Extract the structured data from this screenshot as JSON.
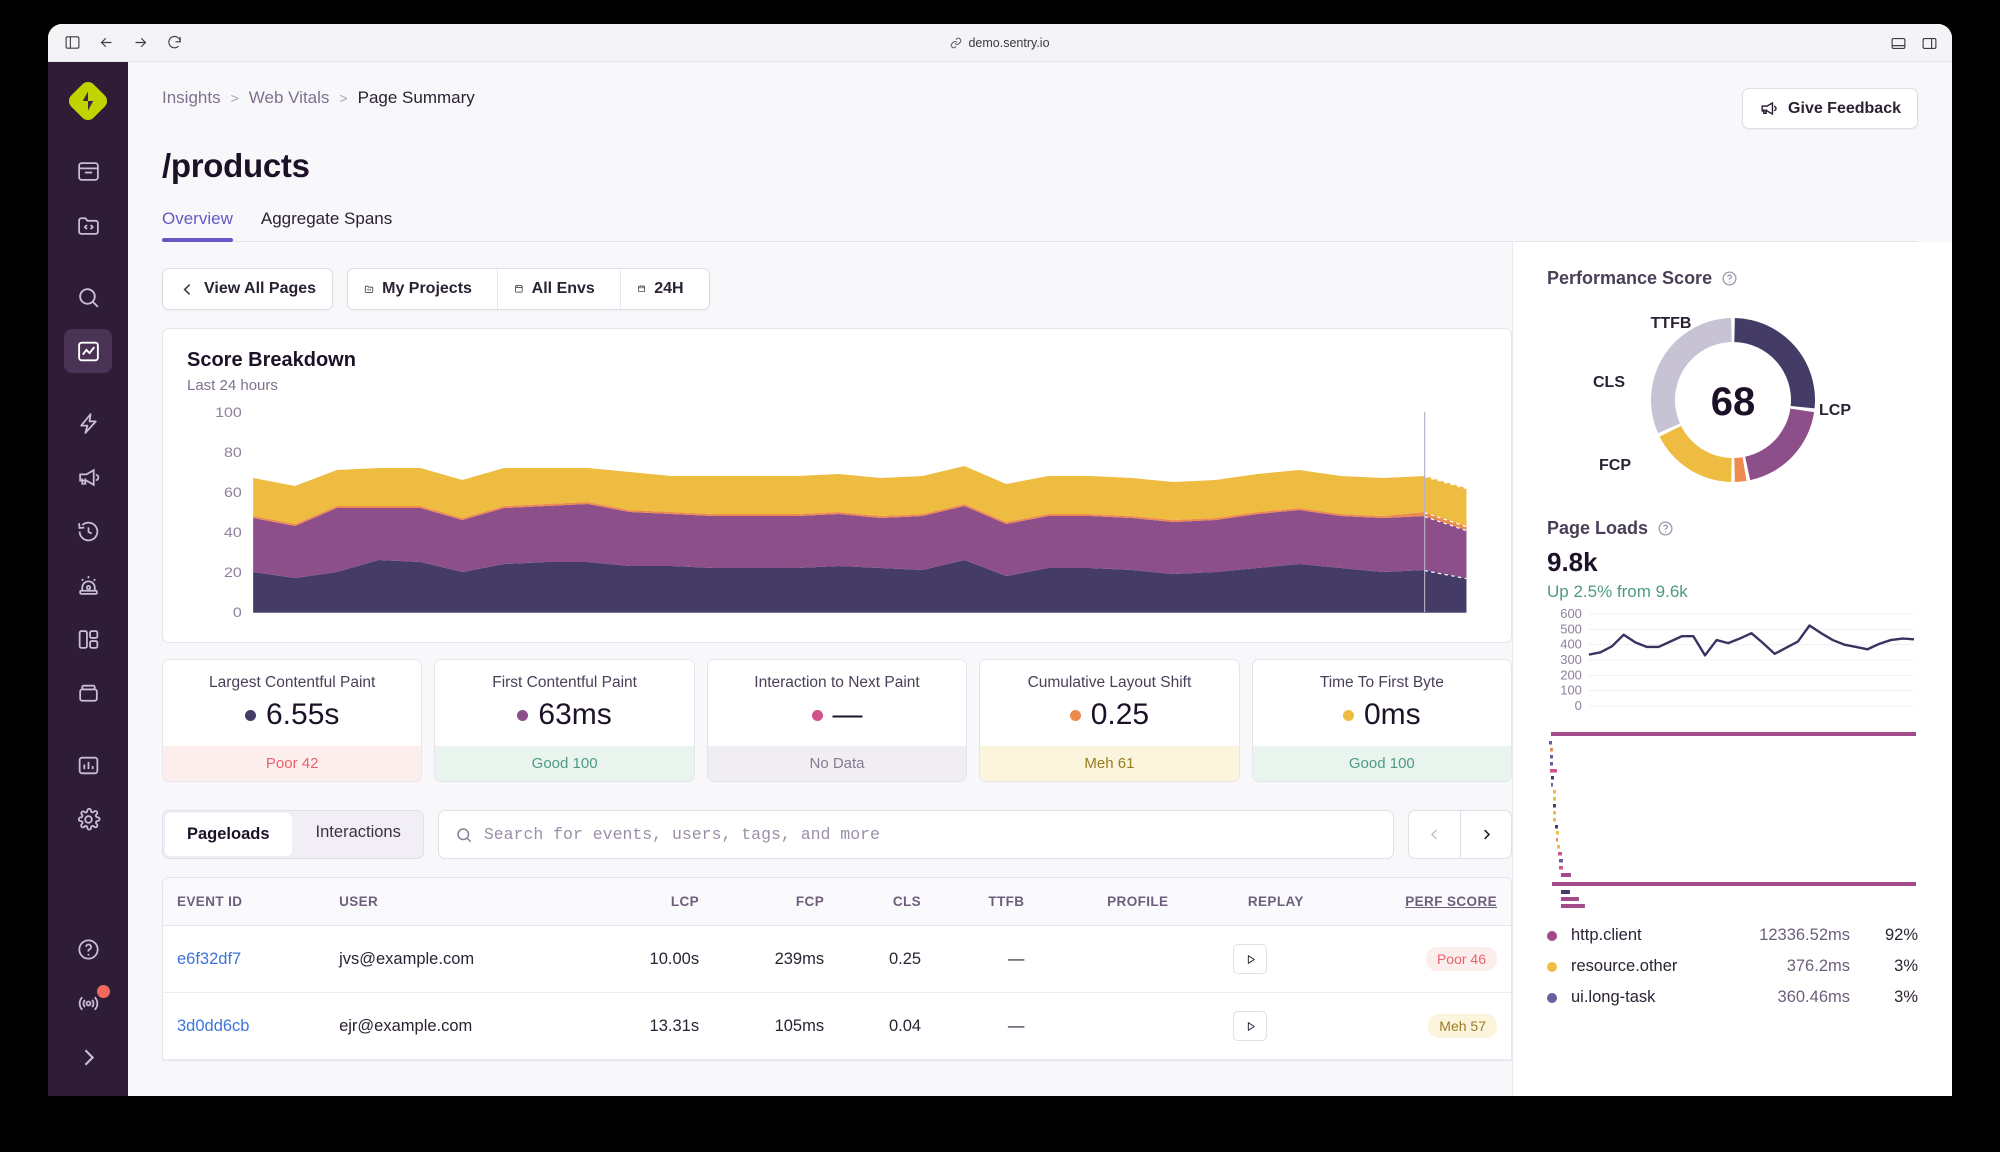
{
  "browser": {
    "url": "demo.sentry.io"
  },
  "sidebar": {
    "items": [
      {
        "name": "issues",
        "icon": "inbox-icon"
      },
      {
        "name": "projects",
        "icon": "code-folder-icon"
      },
      {
        "name": "search",
        "icon": "search-icon"
      },
      {
        "name": "insights",
        "icon": "line-chart-icon",
        "active": true
      },
      {
        "name": "performance",
        "icon": "lightning-icon"
      },
      {
        "name": "feedback",
        "icon": "megaphone-icon"
      },
      {
        "name": "replays",
        "icon": "history-clock-icon"
      },
      {
        "name": "alerts",
        "icon": "siren-icon"
      },
      {
        "name": "dashboards",
        "icon": "dashboard-grid-icon"
      },
      {
        "name": "releases",
        "icon": "releases-box-icon"
      },
      {
        "name": "stats",
        "icon": "bar-chart-icon"
      },
      {
        "name": "settings",
        "icon": "gear-icon"
      }
    ],
    "help_icon": "question-circle-icon",
    "broadcast_icon": "broadcast-icon",
    "expand_icon": "chevron-right-icon"
  },
  "header": {
    "breadcrumb": {
      "item1": "Insights",
      "item2": "Web Vitals",
      "current": "Page Summary",
      "separator": ">"
    },
    "title": "/products",
    "feedback_label": "Give Feedback",
    "tabs": [
      {
        "label": "Overview",
        "active": true
      },
      {
        "label": "Aggregate Spans",
        "active": false
      }
    ]
  },
  "filters": {
    "view_all_pages": "View All Pages",
    "projects": "My Projects",
    "envs": "All Envs",
    "period": "24H"
  },
  "score_breakdown": {
    "title": "Score Breakdown",
    "subtitle": "Last 24 hours"
  },
  "cards": [
    {
      "title": "Largest Contentful Paint",
      "value": "6.55s",
      "dot": "#443c67",
      "foot": "Poor 42",
      "foot_class": "poor"
    },
    {
      "title": "First Contentful Paint",
      "value": "63ms",
      "dot": "#8d4f8a",
      "foot": "Good 100",
      "foot_class": "good"
    },
    {
      "title": "Interaction to Next Paint",
      "value": "—",
      "dot": "#d1518a",
      "foot": "No Data",
      "foot_class": "none"
    },
    {
      "title": "Cumulative Layout Shift",
      "value": "0.25",
      "dot": "#ed8b4f",
      "foot": "Meh 61",
      "foot_class": "meh"
    },
    {
      "title": "Time To First Byte",
      "value": "0ms",
      "dot": "#eebc41",
      "foot": "Good 100",
      "foot_class": "good"
    }
  ],
  "table_controls": {
    "toggle": [
      {
        "label": "Pageloads",
        "active": true
      },
      {
        "label": "Interactions",
        "active": false
      }
    ],
    "search_placeholder": "Search for events, users, tags, and more",
    "prev_icon": "chevron-left-icon",
    "next_icon": "chevron-right-icon"
  },
  "events_table": {
    "columns": [
      "EVENT ID",
      "USER",
      "LCP",
      "FCP",
      "CLS",
      "TTFB",
      "PROFILE",
      "REPLAY",
      "PERF SCORE"
    ],
    "sorted_column": "PERF SCORE",
    "rows": [
      {
        "event_id": "e6f32df7",
        "user": "jvs@example.com",
        "lcp": "10.00s",
        "fcp": "239ms",
        "cls": "0.25",
        "ttfb": "—",
        "profile": "",
        "replay": "play-icon",
        "score": "Poor 46",
        "score_class": "poor"
      },
      {
        "event_id": "3d0dd6cb",
        "user": "ejr@example.com",
        "lcp": "13.31s",
        "fcp": "105ms",
        "cls": "0.04",
        "ttfb": "—",
        "profile": "",
        "replay": "play-icon",
        "score": "Meh 57",
        "score_class": "meh"
      }
    ]
  },
  "performance_score": {
    "title": "Performance Score",
    "score": "68",
    "labels": {
      "ttfb": "TTFB",
      "cls": "CLS",
      "fcp": "FCP",
      "lcp": "LCP"
    }
  },
  "page_loads": {
    "title": "Page Loads",
    "value": "9.8k",
    "delta": "Up 2.5% from 9.6k"
  },
  "spans_legend": [
    {
      "name": "http.client",
      "value": "12336.52ms",
      "pct": "92%",
      "color": "#a34a8a"
    },
    {
      "name": "resource.other",
      "value": "376.2ms",
      "pct": "3%",
      "color": "#eebc41"
    },
    {
      "name": "ui.long-task",
      "value": "360.46ms",
      "pct": "3%",
      "color": "#6b5c9e"
    }
  ],
  "chart_data": [
    {
      "type": "area",
      "title": "Score Breakdown",
      "subtitle": "Last 24 hours",
      "ylabel": "",
      "ylim": [
        0,
        100
      ],
      "yticks": [
        0,
        20,
        40,
        60,
        80,
        100
      ],
      "grid": false,
      "stacked": true,
      "series": [
        {
          "name": "LCP",
          "color": "#443c67",
          "values": [
            20,
            17,
            20,
            26,
            25,
            20,
            24,
            25,
            25,
            23,
            23,
            22,
            22,
            22,
            23,
            22,
            21,
            26,
            18,
            22,
            22,
            21,
            19,
            20,
            22,
            24,
            22,
            20,
            21,
            17
          ]
        },
        {
          "name": "FCP",
          "color": "#8d4f8a",
          "values": [
            27,
            26,
            32,
            26,
            27,
            26,
            28,
            28,
            29,
            27,
            26,
            26,
            26,
            26,
            26,
            25,
            27,
            27,
            26,
            26,
            26,
            26,
            26,
            26,
            27,
            27,
            26,
            27,
            27,
            24
          ]
        },
        {
          "name": "CLS",
          "color": "#ed8b4f",
          "values": [
            1,
            1,
            1,
            1,
            1,
            1,
            1,
            1,
            1,
            1,
            1,
            1,
            1,
            1,
            1,
            1,
            1,
            1,
            1,
            1,
            1,
            1,
            1,
            1,
            1,
            1,
            1,
            1,
            2,
            2
          ]
        },
        {
          "name": "TTFB",
          "color": "#eebc41",
          "values": [
            19,
            19,
            18,
            19,
            19,
            19,
            19,
            18,
            17,
            19,
            18,
            19,
            19,
            19,
            19,
            19,
            19,
            19,
            19,
            19,
            19,
            19,
            19,
            19,
            19,
            19,
            19,
            19,
            18,
            19
          ]
        }
      ]
    },
    {
      "type": "pie",
      "title": "Performance Score",
      "center_label": "68",
      "labels": [
        "LCP",
        "FCP",
        "CLS",
        "TTFB",
        "Remaining"
      ],
      "values": [
        27,
        20,
        3,
        18,
        32
      ],
      "colors": [
        "#443c67",
        "#8d4f8a",
        "#ed8b4f",
        "#eebc41",
        "#c7c3d4"
      ]
    },
    {
      "type": "line",
      "title": "Page Loads",
      "ylim": [
        0,
        600
      ],
      "yticks": [
        0,
        100,
        200,
        300,
        400,
        500,
        600
      ],
      "color": "#3a3260",
      "values": [
        335,
        350,
        390,
        465,
        415,
        385,
        385,
        420,
        455,
        455,
        330,
        430,
        410,
        440,
        475,
        410,
        340,
        380,
        420,
        525,
        475,
        430,
        400,
        385,
        370,
        405,
        430,
        440,
        435
      ]
    }
  ]
}
